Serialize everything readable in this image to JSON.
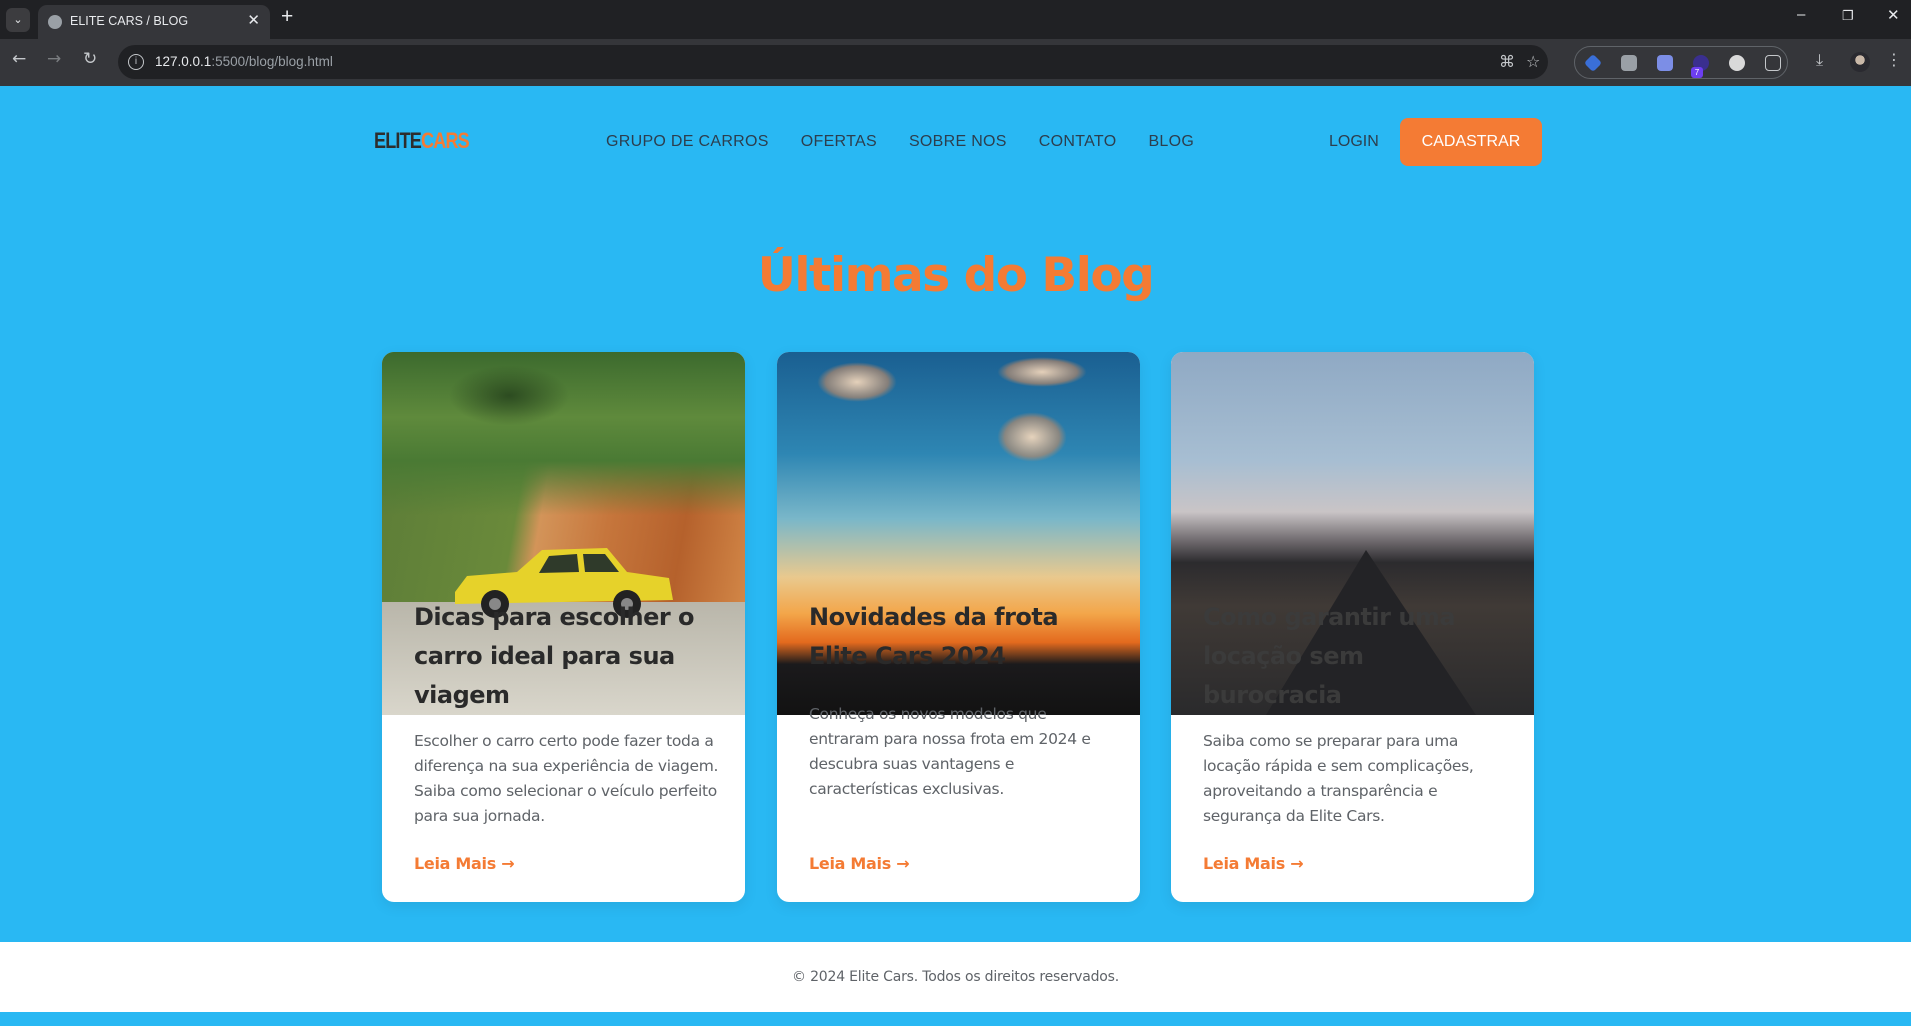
{
  "browser": {
    "tab_title": "ELITE CARS / BLOG",
    "url_host": "127.0.0.1",
    "url_path": ":5500/blog/blog.html",
    "extension_badge": "7"
  },
  "header": {
    "logo_part1": "ELITE",
    "logo_part2": "CARS",
    "nav": [
      "GRUPO DE CARROS",
      "OFERTAS",
      "SOBRE NOS",
      "CONTATO",
      "BLOG"
    ],
    "login": "LOGIN",
    "signup": "CADASTRAR"
  },
  "page_title": "Últimas do Blog",
  "posts": [
    {
      "title": "Dicas para escolher o carro ideal para sua viagem",
      "description": "Escolher o carro certo pode fazer toda a diferença na sua experiência de viagem. Saiba como selecionar o veículo perfeito para sua jornada.",
      "link": "Leia Mais →"
    },
    {
      "title": "Novidades da frota Elite Cars 2024",
      "description": "Conheça os novos modelos que entraram para nossa frota em 2024 e descubra suas vantagens e características exclusivas.",
      "link": "Leia Mais →"
    },
    {
      "title": "Como garantir uma locação sem burocracia",
      "description": "Saiba como se preparar para uma locação rápida e sem complicações, aproveitando a transparência e segurança da Elite Cars.",
      "link": "Leia Mais →"
    }
  ],
  "footer": "© 2024 Elite Cars. Todos os direitos reservados.",
  "colors": {
    "background": "#29b8f3",
    "accent": "#f47b34",
    "nav_text": "#2c3e4e"
  }
}
